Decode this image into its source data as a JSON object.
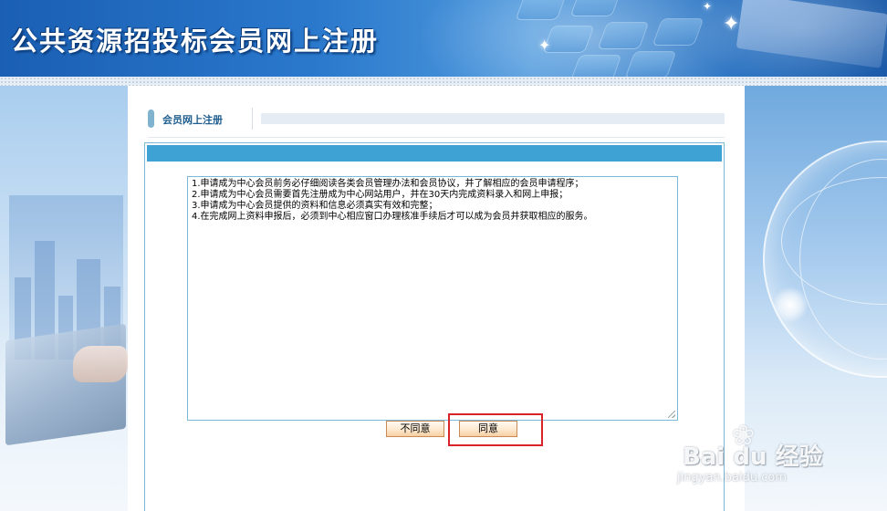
{
  "header": {
    "title": "公共资源招投标会员网上注册"
  },
  "section": {
    "title": "会员网上注册"
  },
  "terms": {
    "lines": [
      "1.申请成为中心会员前务必仔细阅读各类会员管理办法和会员协议，并了解相应的会员申请程序；",
      "2.申请成为中心会员需要首先注册成为中心网站用户，并在30天内完成资料录入和网上申报；",
      "3.申请成为中心会员提供的资料和信息必须真实有效和完整；",
      "4.在完成网上资料申报后，必须到中心相应窗口办理核准手续后才可以成为会员并获取相应的服务。"
    ]
  },
  "buttons": {
    "disagree_label": "不同意",
    "agree_label": "同意"
  },
  "watermark": {
    "brand": "Bai du 经验",
    "url": "jingyan.baidu.com"
  },
  "colors": {
    "banner": "#2a78cc",
    "panel_bar": "#3ea2d4",
    "panel_border": "#7ab8d8",
    "highlight": "#d8232a",
    "section_title": "#1f5e8f"
  },
  "icons": {
    "section_marker": "section-marker-icon",
    "watermark_paw": "paw-icon"
  }
}
